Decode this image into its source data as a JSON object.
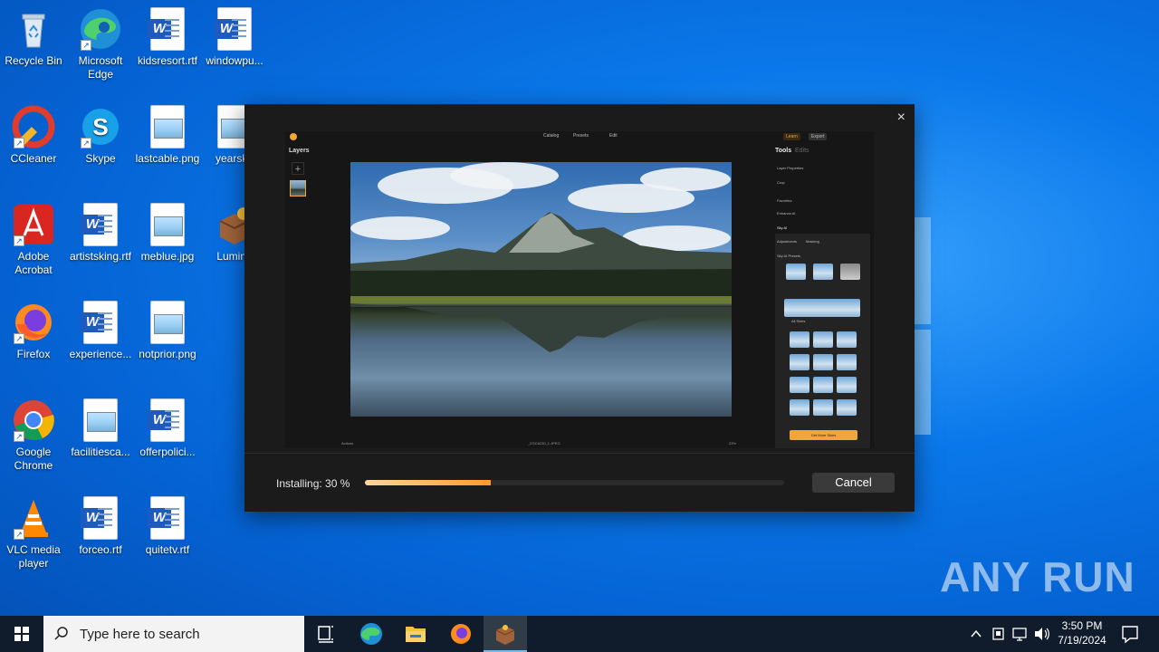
{
  "desktop": {
    "icons": [
      {
        "label": "Recycle Bin"
      },
      {
        "label": "Microsoft Edge"
      },
      {
        "label": "kidsresort.rtf"
      },
      {
        "label": "windowpu..."
      },
      {
        "label": "CCleaner"
      },
      {
        "label": "Skype"
      },
      {
        "label": "lastcable.png"
      },
      {
        "label": "yearskb"
      },
      {
        "label": "Adobe Acrobat"
      },
      {
        "label": "artistsking.rtf"
      },
      {
        "label": "meblue.jpg"
      },
      {
        "label": "Lumina"
      },
      {
        "label": "Firefox"
      },
      {
        "label": "experience..."
      },
      {
        "label": "notprior.png"
      },
      {
        "label": "Google Chrome"
      },
      {
        "label": "facilitiesca..."
      },
      {
        "label": "offerpolici..."
      },
      {
        "label": "VLC media player"
      },
      {
        "label": "forceo.rtf"
      },
      {
        "label": "quitetv.rtf"
      }
    ]
  },
  "installer": {
    "close_glyph": "×",
    "status_text": "Installing: 30 %",
    "progress": 0.3,
    "cancel_label": "Cancel",
    "preview": {
      "tabs": [
        "Catalog",
        "Presets",
        "Edit"
      ],
      "right_buttons": [
        "Learn",
        "Export"
      ],
      "layers_label": "Layers",
      "add_glyph": "+",
      "tools_label": "Tools",
      "edits_label": "Edits",
      "tool_rows": [
        "Layer Properties",
        "Crop",
        "Favorites",
        "Enhance AI",
        "Sky AI"
      ],
      "sky_tabs": [
        "Adjustments",
        "Masking"
      ],
      "sky_section": "Sky AI Presets",
      "sky_dropdown": "All Skies",
      "get_more_label": "Get More Skies",
      "bottom": {
        "actions": "Actions",
        "filename": "_DSC6230_1.JPEG",
        "zoom": "23%"
      }
    }
  },
  "taskbar": {
    "search_placeholder": "Type here to search",
    "time": "3:50 PM",
    "date": "7/19/2024"
  },
  "watermark": "ANY RUN"
}
